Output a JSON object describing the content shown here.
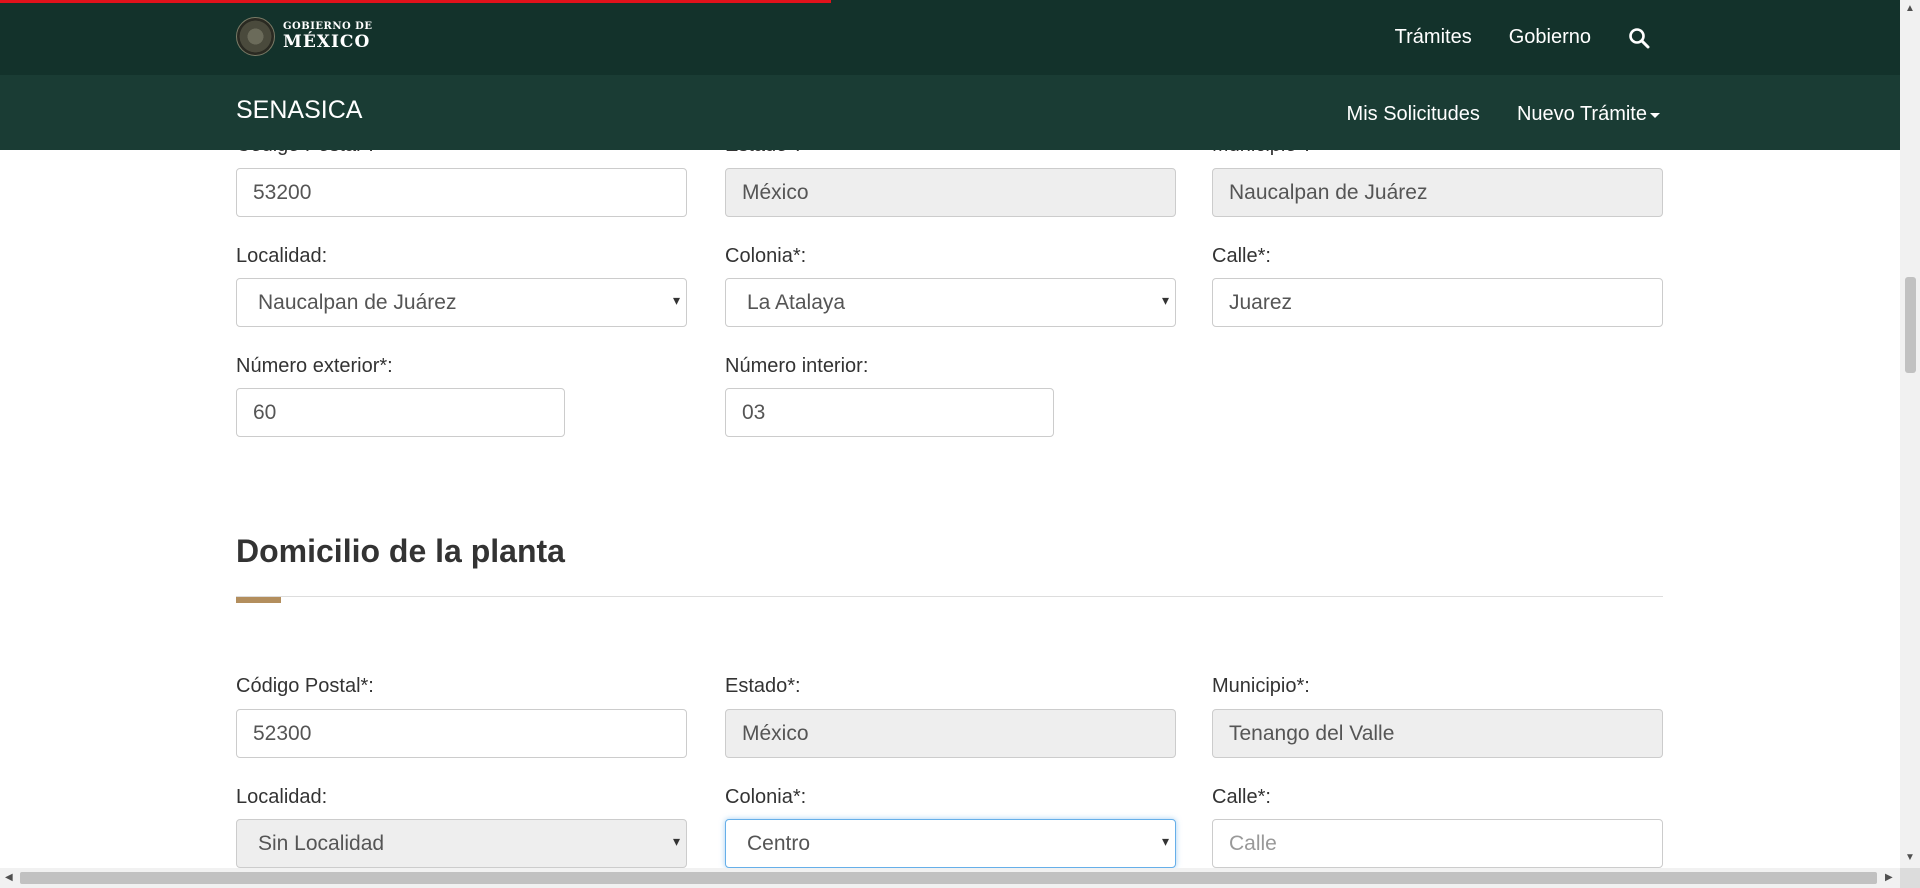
{
  "header": {
    "logo_small": "GOBIERNO DE",
    "logo_big": "MÉXICO",
    "nav": [
      "Trámites",
      "Gobierno"
    ],
    "search_icon": "search-icon"
  },
  "subheader": {
    "brand": "SENASICA",
    "nav": [
      "Mis Solicitudes",
      "Nuevo Trámite"
    ]
  },
  "fiscal": {
    "cp_label": "Código Postal*:",
    "estado_label": "Estado*:",
    "municipio_label": "Municipio*:",
    "cp_value": "53200",
    "estado_value": "México",
    "municipio_value": "Naucalpan de Juárez",
    "localidad_label": "Localidad:",
    "localidad_value": "Naucalpan de Juárez",
    "colonia_label": "Colonia*:",
    "colonia_value": "La Atalaya",
    "calle_label": "Calle*:",
    "calle_value": "Juarez",
    "num_ext_label": "Número exterior*:",
    "num_ext_value": "60",
    "num_int_label": "Número interior:",
    "num_int_value": "03"
  },
  "planta": {
    "title": "Domicilio de la planta",
    "cp_label": "Código Postal*:",
    "cp_value": "52300",
    "estado_label": "Estado*:",
    "estado_value": "México",
    "municipio_label": "Municipio*:",
    "municipio_value": "Tenango del Valle",
    "localidad_label": "Localidad:",
    "localidad_value": "Sin Localidad",
    "colonia_label": "Colonia*:",
    "colonia_value": "Centro",
    "calle_label": "Calle*:",
    "calle_placeholder": "Calle"
  },
  "colors": {
    "topbar": "#13322b",
    "subbar": "#1a3c34",
    "accent": "#b38e5d",
    "progress": "#e0121b"
  }
}
